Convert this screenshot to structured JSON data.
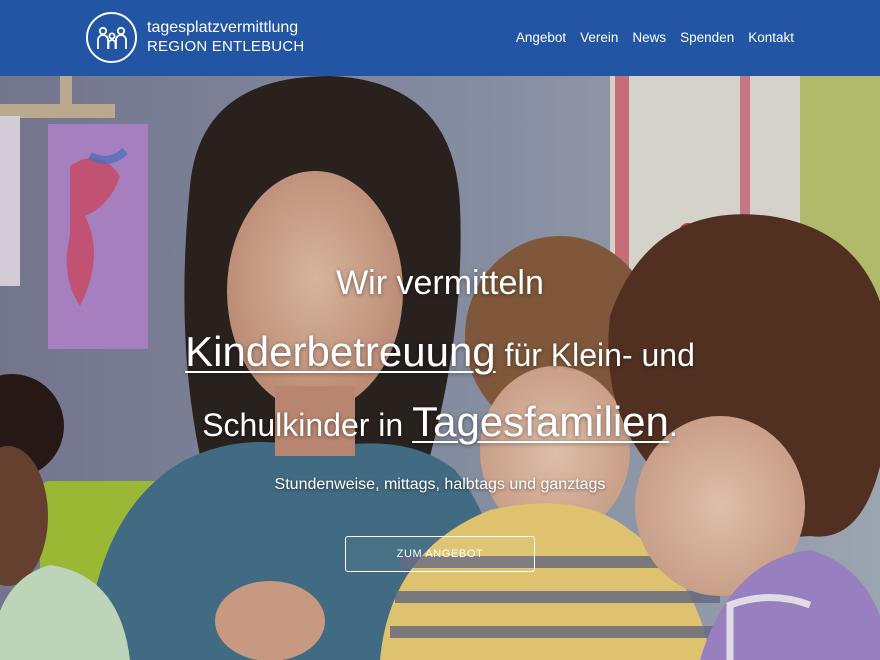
{
  "brand": {
    "line1": "tagesplatzvermittlung",
    "line2": "REGION ENTLEBUCH",
    "icon": "family-icon"
  },
  "nav": {
    "items": [
      "Angebot",
      "Verein",
      "News",
      "Spenden",
      "Kontakt"
    ]
  },
  "hero": {
    "line1": "Wir vermitteln",
    "line2_highlight": "Kinderbetreuung",
    "line2_rest": " für Klein- und",
    "line3_start": "Schulkinder in ",
    "line3_highlight": "Tagesfamilien",
    "line3_end": ".",
    "subline": "Stundenweise, mittags, halbtags und ganztags",
    "cta_label": "ZUM ANGEBOT"
  },
  "colors": {
    "header": "#2355a5",
    "text": "#ffffff"
  }
}
